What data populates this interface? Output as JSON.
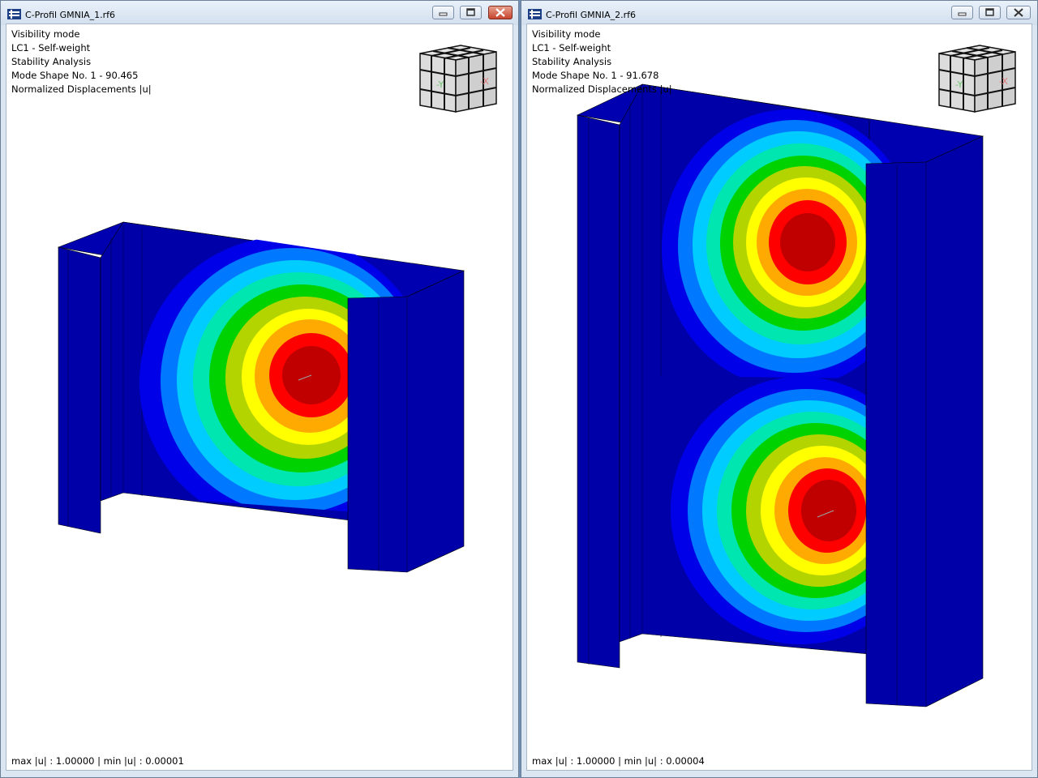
{
  "windows": [
    {
      "title": "C-Profil GMNIA_1.rf6",
      "info_lines": [
        "Visibility mode",
        "LC1 - Self-weight",
        "Stability Analysis",
        "Mode Shape No. 1 - 90.465",
        "Normalized Displacements |u|"
      ],
      "status": "max |u| : 1.00000 | min |u| : 0.00001",
      "close_active": true,
      "view_cube": {
        "axis_y": "-Y",
        "axis_x": "-X"
      }
    },
    {
      "title": "C-Profil GMNIA_2.rf6",
      "info_lines": [
        "Visibility mode",
        "LC1 - Self-weight",
        "Stability Analysis",
        "Mode Shape No. 1 - 91.678",
        "Normalized Displacements |u|"
      ],
      "status": "max |u| : 1.00000 | min |u| : 0.00004",
      "close_active": false,
      "view_cube": {
        "axis_y": "-Y",
        "axis_x": "-X"
      }
    }
  ],
  "colors": {
    "contour_bands": [
      "#0000a8",
      "#0000e8",
      "#0078ff",
      "#00ccff",
      "#00e6b0",
      "#00d200",
      "#b4d400",
      "#ffff00",
      "#ffaa00",
      "#ff0000",
      "#c00000"
    ],
    "member_blue": "#0000a8",
    "window_frame": "#dbe6f3",
    "close_button": "#c6452d"
  }
}
